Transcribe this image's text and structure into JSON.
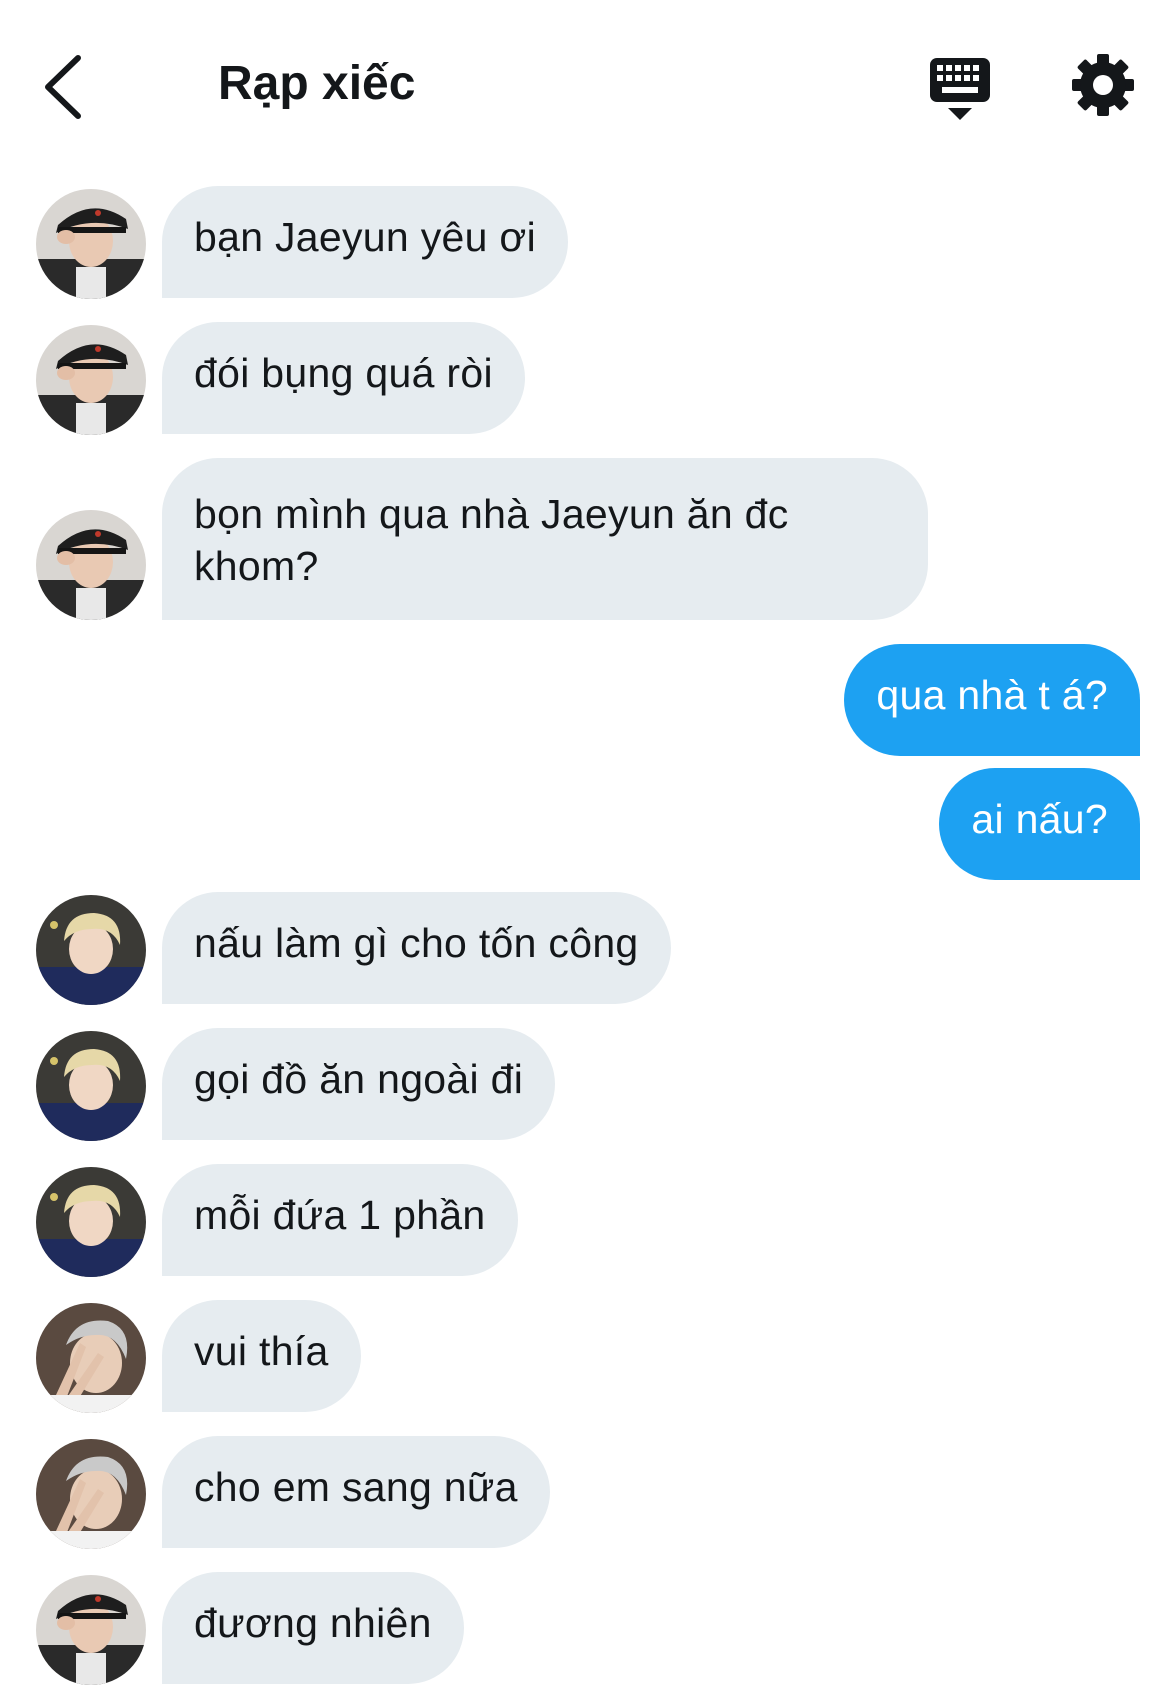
{
  "header": {
    "title": "Rạp xiếc",
    "back_icon": "chevron-left-icon",
    "keyboard_icon": "keyboard-icon",
    "settings_icon": "gear-icon"
  },
  "colors": {
    "incoming_bubble": "#e6ecf0",
    "outgoing_bubble": "#1da1f2",
    "text": "#14171a"
  },
  "messages": [
    {
      "from": "cap-user",
      "text": "bạn Jaeyun yêu ơi"
    },
    {
      "from": "cap-user",
      "text": "đói bụng quá ròi"
    },
    {
      "from": "cap-user",
      "text": "bọn mình qua nhà Jaeyun ăn đc khom?"
    },
    {
      "from": "me",
      "text": "qua nhà t á?"
    },
    {
      "from": "me",
      "text": "ai nấu?"
    },
    {
      "from": "blond-user",
      "text": "nấu làm gì cho tốn công"
    },
    {
      "from": "blond-user",
      "text": "gọi đồ ăn ngoài đi"
    },
    {
      "from": "blond-user",
      "text": "mỗi đứa 1 phần"
    },
    {
      "from": "silver-user",
      "text": "vui thía"
    },
    {
      "from": "silver-user",
      "text": "cho em sang nữa"
    },
    {
      "from": "cap-user",
      "text": "đương nhiên"
    }
  ]
}
